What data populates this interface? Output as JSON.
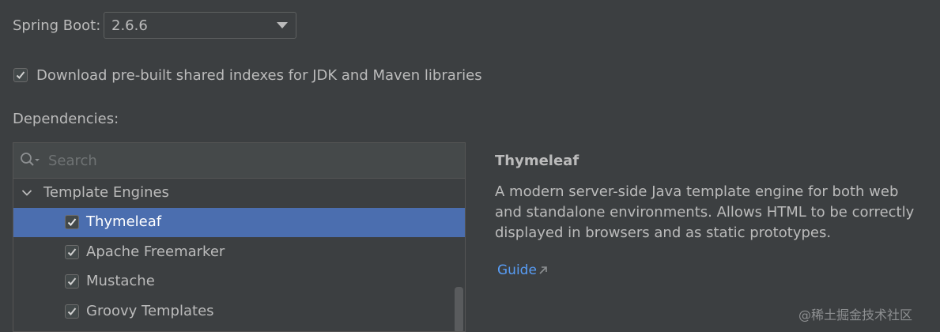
{
  "spring_boot": {
    "label": "Spring Boot:",
    "selected_version": "2.6.6"
  },
  "prebuilt_indexes": {
    "checked": true,
    "label": "Download pre-built shared indexes for JDK and Maven libraries"
  },
  "dependencies": {
    "label": "Dependencies:",
    "search_placeholder": "Search",
    "group": {
      "label": "Template Engines",
      "expanded": true
    },
    "items": [
      {
        "label": "Thymeleaf",
        "checked": true,
        "selected": true
      },
      {
        "label": "Apache Freemarker",
        "checked": true,
        "selected": false
      },
      {
        "label": "Mustache",
        "checked": true,
        "selected": false
      },
      {
        "label": "Groovy Templates",
        "checked": true,
        "selected": false
      }
    ]
  },
  "details": {
    "title": "Thymeleaf",
    "description": "A modern server-side Java template engine for both web and standalone environments. Allows HTML to be correctly displayed in browsers and as static prototypes.",
    "guide_label": "Guide"
  },
  "watermark": "@稀土掘金技术社区",
  "colors": {
    "background": "#3c3f41",
    "selection": "#4b6eaf",
    "link": "#589df6"
  }
}
